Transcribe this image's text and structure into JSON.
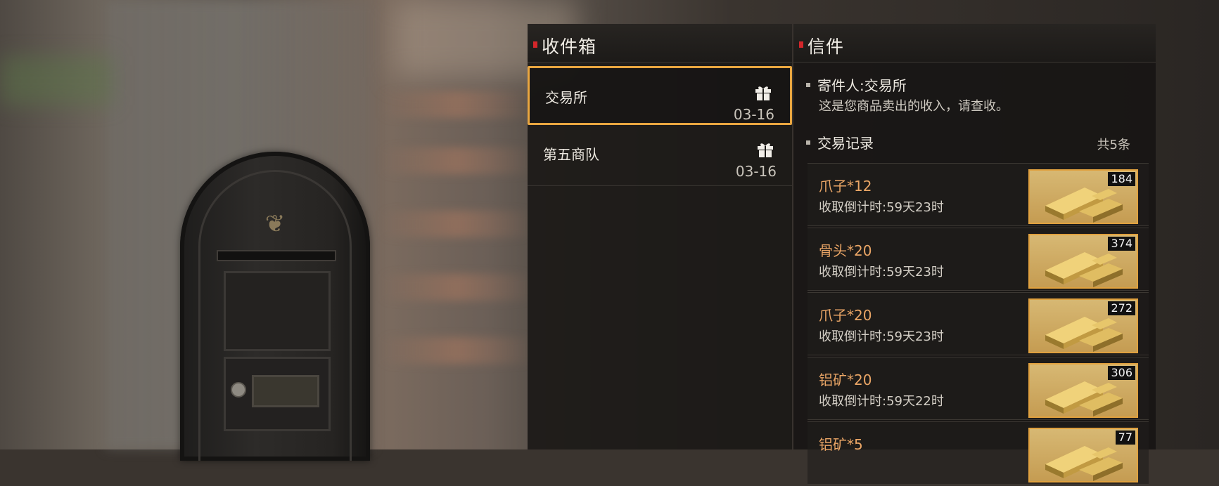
{
  "inbox": {
    "title": "收件箱"
  },
  "mail": {
    "title": "信件"
  },
  "mails": [
    {
      "sender": "交易所",
      "date": "03-16",
      "selected": true
    },
    {
      "sender": "第五商队",
      "date": "03-16",
      "selected": false
    }
  ],
  "letter": {
    "sender_line": "寄件人:交易所",
    "message": "这是您商品卖出的收入，请查收。",
    "records_title": "交易记录",
    "records_count": "共5条",
    "records": [
      {
        "item": "爪子*12",
        "timer": "收取倒计时:59天23时",
        "qty": "184"
      },
      {
        "item": "骨头*20",
        "timer": "收取倒计时:59天23时",
        "qty": "374"
      },
      {
        "item": "爪子*20",
        "timer": "收取倒计时:59天23时",
        "qty": "272"
      },
      {
        "item": "铝矿*20",
        "timer": "收取倒计时:59天22时",
        "qty": "306"
      },
      {
        "item": "铝矿*5",
        "timer": "",
        "qty": "77"
      }
    ]
  },
  "colors": {
    "accent_red": "#d4262a",
    "selection_orange": "#e9a640",
    "item_text": "#eba666"
  },
  "icons": {
    "gift": "gift-icon",
    "reward": "gold-bar-icon"
  }
}
